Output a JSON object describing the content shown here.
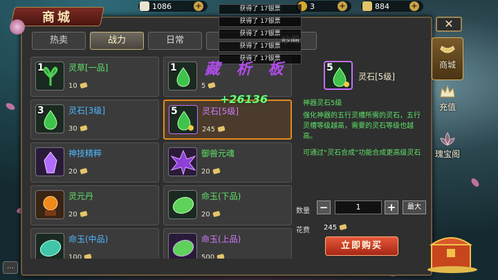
{
  "currency": [
    {
      "name": "scroll",
      "value": "1086"
    },
    {
      "name": "gold-ingot",
      "value": "3"
    },
    {
      "name": "silver-ticket",
      "value": "884"
    }
  ],
  "notifications": [
    "获得了 17银票",
    "获得了 17银票",
    "获得了 17银票",
    "获得了 17银票",
    "获得了 17银票"
  ],
  "panel": {
    "title": "商城"
  },
  "tabs": [
    {
      "label": "热卖",
      "active": false
    },
    {
      "label": "战力",
      "active": true
    },
    {
      "label": "日常",
      "active": false
    },
    {
      "label": "紗阁",
      "active": false
    }
  ],
  "items": [
    {
      "num": "1",
      "name": "灵草[一品]",
      "price": "10",
      "color": "green",
      "icon": "herb-icon",
      "selected": false
    },
    {
      "num": "1",
      "name": "",
      "price": "5",
      "color": "green",
      "icon": "green-stone-icon",
      "selected": false
    },
    {
      "num": "3",
      "name": "灵石[3级]",
      "price": "30",
      "color": "blue",
      "icon": "green-stone-icon",
      "selected": false
    },
    {
      "num": "5",
      "name": "灵石[5级]",
      "price": "245",
      "color": "purple",
      "icon": "green-stone-icon",
      "selected": true
    },
    {
      "num": "",
      "name": "神技精粹",
      "price": "20",
      "color": "blue",
      "icon": "crystal-icon",
      "selected": false
    },
    {
      "num": "",
      "name": "御兽元魂",
      "price": "20",
      "color": "green",
      "icon": "beast-soul-icon",
      "selected": false
    },
    {
      "num": "",
      "name": "灵元丹",
      "price": "20",
      "color": "green",
      "icon": "pill-icon",
      "selected": false
    },
    {
      "num": "",
      "name": "命玉(下品)",
      "price": "20",
      "color": "green",
      "icon": "jade-icon",
      "selected": false
    },
    {
      "num": "",
      "name": "命玉(中品)",
      "price": "100",
      "color": "blue",
      "icon": "jade-icon",
      "selected": false
    },
    {
      "num": "",
      "name": "命玉(上品)",
      "price": "500",
      "color": "purple",
      "icon": "jade-icon",
      "selected": false
    }
  ],
  "floater": "+26136",
  "watermark": "藏 析 板",
  "detail": {
    "num": "5",
    "name": "灵石[5级]",
    "subtitle": "神器灵石5级",
    "description": "强化神器的五行灵槽所需的灵石，五行灵槽等级越高，需要的灵石等级也越高。",
    "hint": "可通过“灵石合成”功能合成更高级灵石",
    "qty_label": "数量",
    "qty_value": "1",
    "max_label": "最大",
    "cost_label": "花费",
    "cost_value": "245",
    "buy_label": "立即购买"
  },
  "close_label": "✕",
  "side_nav": [
    {
      "label": "商城",
      "active": true
    },
    {
      "label": "充值",
      "active": false
    },
    {
      "label": "瑰宝阁",
      "active": false
    }
  ],
  "colors": {
    "green": "#5fe068",
    "blue": "#4fb8ff",
    "purple": "#d07cff",
    "accent": "#e58a1f"
  }
}
